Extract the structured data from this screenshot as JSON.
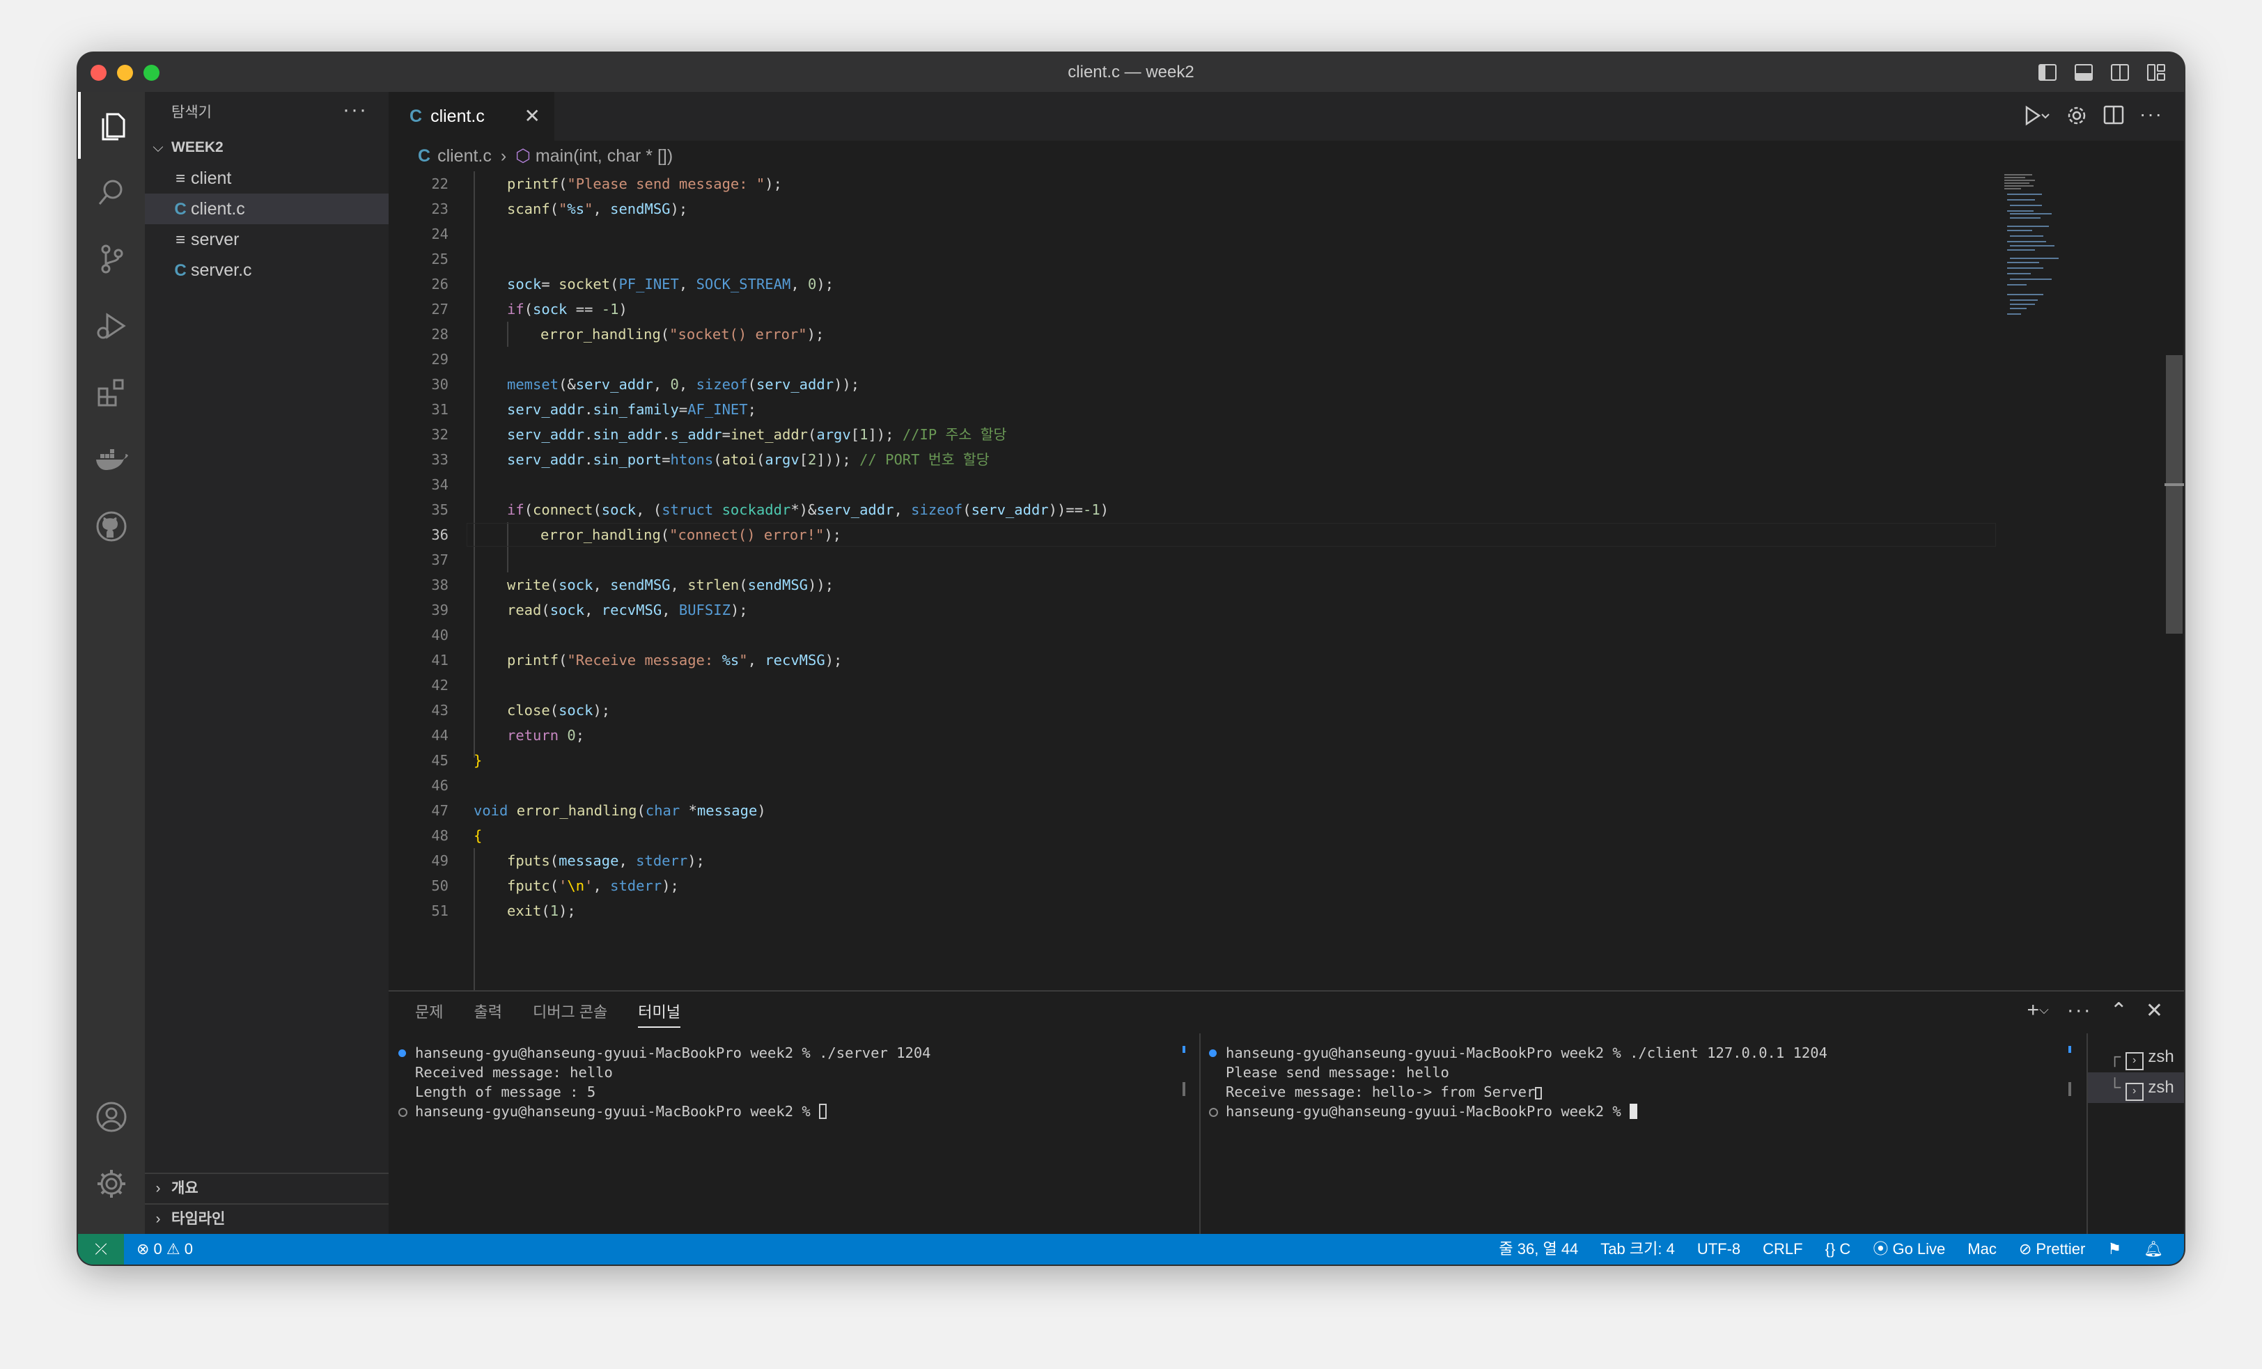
{
  "window": {
    "title": "client.c — week2"
  },
  "sidebar": {
    "header": "탐색기",
    "folder": "WEEK2",
    "files": [
      {
        "icon": "≡",
        "name": "client"
      },
      {
        "icon": "C",
        "name": "client.c"
      },
      {
        "icon": "≡",
        "name": "server"
      },
      {
        "icon": "C",
        "name": "server.c"
      }
    ],
    "outline": "개요",
    "timeline": "타임라인"
  },
  "editor": {
    "tab": {
      "icon": "C",
      "name": "client.c",
      "close": "✕"
    },
    "breadcrumb": {
      "file": "client.c",
      "symbol": "main(int, char * [])"
    },
    "current_line": "36"
  },
  "panel": {
    "tabs": [
      "문제",
      "출력",
      "디버그 콘솔",
      "터미널"
    ],
    "terminal_left": [
      "hanseung-gyu@hanseung-gyuui-MacBookPro week2 % ./server 1204",
      "Received message: hello",
      "Length of message : 5",
      "hanseung-gyu@hanseung-gyuui-MacBookPro week2 % "
    ],
    "terminal_right": [
      "hanseung-gyu@hanseung-gyuui-MacBookPro week2 % ./client 127.0.0.1 1204",
      "Please send message: hello",
      "Receive message: hello-> from Server",
      "hanseung-gyu@hanseung-gyuui-MacBookPro week2 % "
    ],
    "terminals": [
      "zsh",
      "zsh"
    ]
  },
  "statusbar": {
    "problems": "⊗ 0 ⚠ 0",
    "position": "줄 36, 열 44",
    "tab_size": "Tab 크기: 4",
    "encoding": "UTF-8",
    "eol": "CRLF",
    "language": "{} C",
    "golive": "Go Live",
    "platform": "Mac",
    "prettier": "Prettier"
  },
  "colors": {
    "accent": "#007acc",
    "remote": "#16825d",
    "editor_bg": "#1e1e1e"
  }
}
